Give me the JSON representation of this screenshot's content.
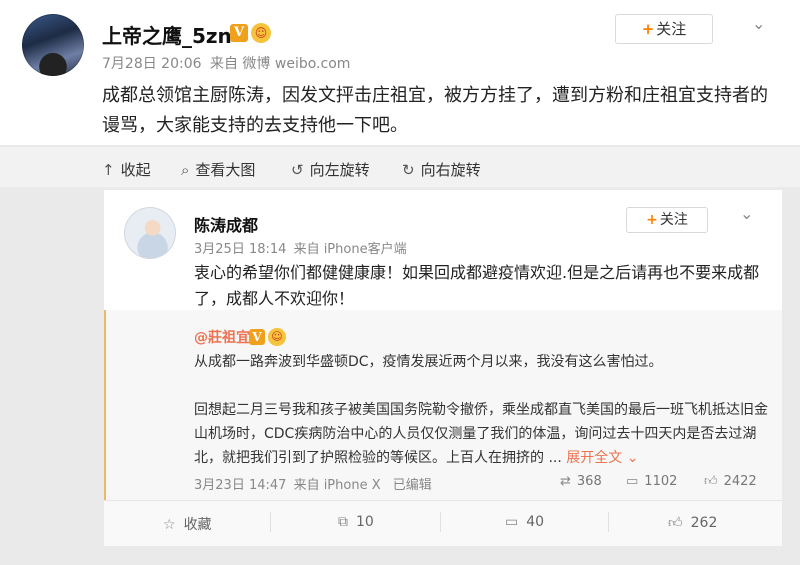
{
  "post": {
    "author": "上帝之鹰_5zn",
    "verified_badge": "V",
    "time": "7月28日 20:06",
    "source": "来自 微博 weibo.com",
    "follow_label": "关注",
    "text": "成都总领馆主厨陈涛，因发文抨击庄祖宜，被方方挂了，遭到方粉和庄祖宜支持者的谩骂，大家能支持的去支持他一下吧。"
  },
  "toolbar": {
    "collapse": "收起",
    "view_large": "查看大图",
    "rotate_left": "向左旋转",
    "rotate_right": "向右旋转"
  },
  "repost": {
    "author": "陈涛成都",
    "time": "3月25日 18:14",
    "source": "来自 iPhone客户端",
    "follow_label": "关注",
    "text": "衷心的希望你们都健健康康！如果回成都避疫情欢迎.但是之后请再也不要来成都了，成都人不欢迎你！"
  },
  "quoted": {
    "author": "@莊祖宜",
    "verified_badge": "V",
    "para1": "从成都一路奔波到华盛顿DC，疫情发展近两个月以来，我没有这么害怕过。",
    "para2": "回想起二月三号我和孩子被美国国务院勒令撤侨，乘坐成都直飞美国的最后一班飞机抵达旧金山机场时，CDC疾病防治中心的人员仅仅测量了我们的体温，询问过去十四天内是否去过湖北，就把我们引到了护照检验的等候区。上百人在拥挤的 ...",
    "expand_label": "展开全文",
    "time": "3月23日 14:47",
    "source": "来自 iPhone X",
    "edited": "已编辑",
    "reposts": "368",
    "comments": "1102",
    "likes": "2422"
  },
  "actions": {
    "favorite": "收藏",
    "repost_count": "10",
    "comment_count": "40",
    "like_count": "262"
  },
  "colors": {
    "accent": "#ff8200",
    "link": "#eb7350"
  }
}
